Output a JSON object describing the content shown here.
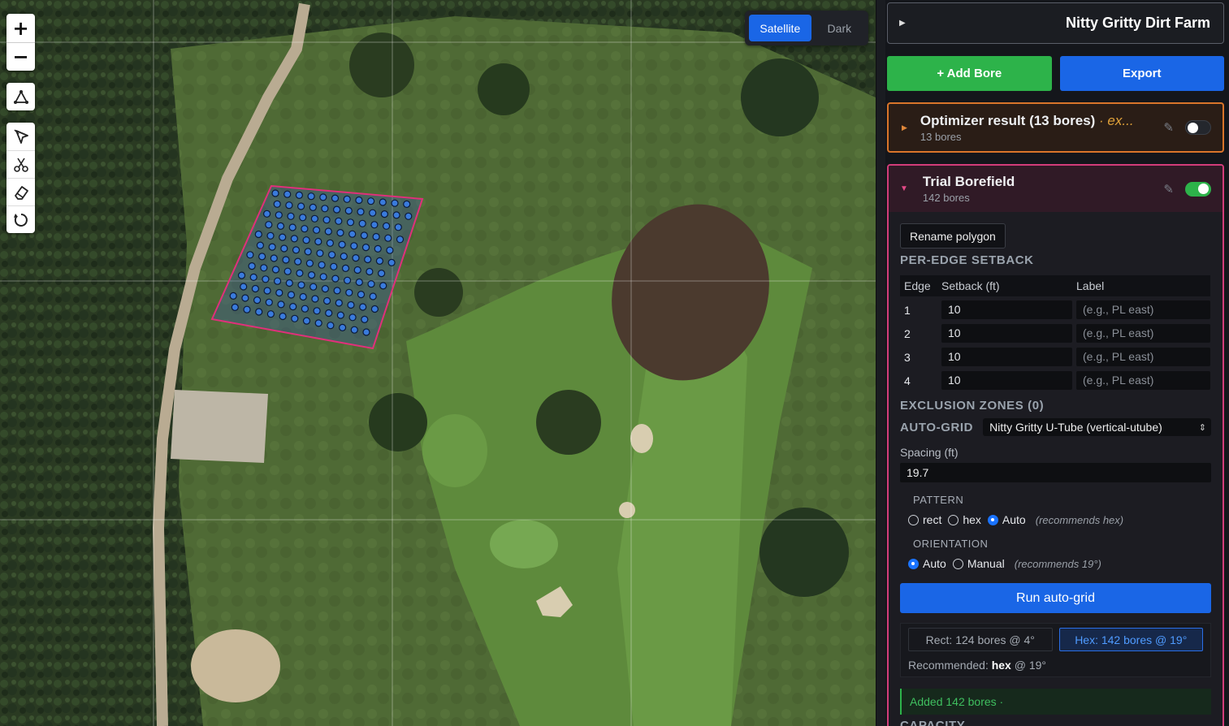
{
  "map": {
    "zoom_in": "+",
    "zoom_out": "−",
    "basemap": {
      "satellite": "Satellite",
      "dark": "Dark"
    },
    "bore_color": "#3a7bdc",
    "polygon_color": "#e0307a"
  },
  "project": {
    "toggle_glyph": "▶",
    "name": "Nitty Gritty Dirt Farm"
  },
  "actions": {
    "add_bore": "+ Add Bore",
    "export": "Export"
  },
  "optimizer": {
    "title": "Optimizer result (13 bores)",
    "tag": " · ex...",
    "subtitle": "13 bores",
    "enabled": false
  },
  "borefield": {
    "title": "Trial Borefield",
    "subtitle": "142 bores",
    "enabled": true,
    "rename_label": "Rename polygon",
    "setback_heading": "PER-EDGE SETBACK",
    "columns": [
      "Edge",
      "Setback (ft)",
      "Label"
    ],
    "edges": [
      {
        "edge": "1",
        "setback": "10",
        "label_placeholder": "(e.g., PL east)"
      },
      {
        "edge": "2",
        "setback": "10",
        "label_placeholder": "(e.g., PL east)"
      },
      {
        "edge": "3",
        "setback": "10",
        "label_placeholder": "(e.g., PL east)"
      },
      {
        "edge": "4",
        "setback": "10",
        "label_placeholder": "(e.g., PL east)"
      }
    ],
    "exclusion_heading": "EXCLUSION ZONES (0)",
    "autogrid_heading": "AUTO-GRID",
    "autogrid_select": "Nitty Gritty U-Tube (vertical-utube)",
    "spacing_label": "Spacing (ft)",
    "spacing_value": "19.7",
    "pattern_heading": "PATTERN",
    "pattern_options": [
      "rect",
      "hex",
      "Auto"
    ],
    "pattern_selected": "Auto",
    "pattern_hint": "(recommends hex)",
    "orientation_heading": "ORIENTATION",
    "orientation_options": [
      "Auto",
      "Manual"
    ],
    "orientation_selected": "Auto",
    "orientation_hint": "(recommends 19°)",
    "run_label": "Run auto-grid",
    "result_rect": "Rect: 124 bores @ 4°",
    "result_hex": "Hex: 142 bores @ 19°",
    "recommended_prefix": "Recommended: ",
    "recommended_pattern": "hex",
    "recommended_suffix": " @ 19°",
    "added_message": "Added 142 bores ·",
    "capacity_heading": "CAPACITY"
  }
}
